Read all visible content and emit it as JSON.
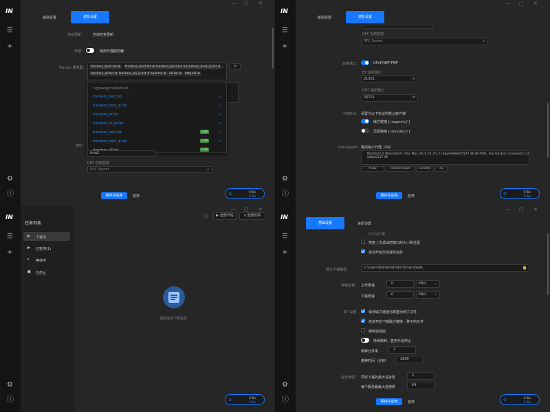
{
  "app": {
    "logo": "IN"
  },
  "sidebar": {
    "menu_icon": "menu-icon",
    "add_icon": "plus-icon",
    "settings_icon": "gear-icon",
    "info_icon": "info-icon"
  },
  "win": {
    "min": "—",
    "max": "▢",
    "close": "✕"
  },
  "tabs": {
    "basic": "基础设置",
    "advanced": "进阶设置"
  },
  "actions": {
    "save": "保存并应用",
    "discard": "放弃"
  },
  "speed": {
    "up": "0 B/s",
    "down": "0 B/s"
  },
  "p1": {
    "auto_update_label": "自动更新：",
    "auto_update_text": "自动检查更新",
    "proxy_label": "代理：",
    "proxy_text": "使用代理服务器",
    "tracker_label": "Tracker 服务器：",
    "tracker_tags": [
      "trackers_best.txt",
      "trackers_best.txt",
      "trackers_best.txt",
      "trackers_best_ip.txt",
      "trackers_all.txt",
      "trackers_all_ip.txt",
      "best.txt",
      "all.txt",
      "http.txt"
    ],
    "dropdown_header": "ngosang/trackerslist",
    "dropdown_items": [
      {
        "name": "trackers_best.txt",
        "cdn": false
      },
      {
        "name": "trackers_best_ip.txt",
        "cdn": false
      },
      {
        "name": "trackers_all.txt",
        "cdn": false
      },
      {
        "name": "trackers_all_ip.txt",
        "cdn": false
      },
      {
        "name": "trackers_best.txt",
        "cdn": true
      },
      {
        "name": "trackers_best_ip.txt",
        "cdn": true
      },
      {
        "name": "trackers_all.txt",
        "cdn": true
      }
    ],
    "cdn_label": "CDN",
    "rpc_label": "RPC:",
    "rpc_value": "Aria2",
    "rpc_secret_label": "RPC 授权密钥",
    "rpc_secret_placeholder": "RPC Secret"
  },
  "p2": {
    "rpc_secret_label": "RPC 授权密钥",
    "rpc_secret_placeholder": "RPC Secret",
    "port_label": "启用端口：",
    "upnp_text": "UPnP/NAT-PMP",
    "bt_port_label": "BT 监听端口",
    "bt_port_value": "21301",
    "dht_port_label": "DHT 监听端口",
    "dht_port_value": "26701",
    "protocol_label": "下载协议：",
    "protocol_desc": "设置为以下协议的默认客户端",
    "magnet_text": "磁力链接 [ magnet:// ]",
    "thunder_text": "迅雷链接 [ thunder:// ]",
    "ua_label": "User-Agent：",
    "ua_desc": "模拟用户代理（UA）",
    "ua_value_1": "Mozilla/5.0 (Macintosh; Intel Mac OS X 10_15_7) AppleWebKit/537.36 (KHTML, like Gecko) Chrome/111.0.0.0",
    "ua_value_2": "Safari/537.36",
    "ua_presets": [
      "Aria2",
      "Transmission",
      "Chrome",
      "du"
    ]
  },
  "p3": {
    "list_title": "任务列表",
    "nav": [
      "下载中",
      "已暂停(1)",
      "等待中",
      "已停止"
    ],
    "start_all": "全部开始",
    "pause_all": "全部暂停",
    "empty_text": "当前没有下载任务"
  },
  "p4": {
    "top_hidden": "打开自动下载",
    "remember_window": "恢复上次退出时窗口的大小和位置",
    "auto_start": "自动开始未完成的任务",
    "dir_label": "默认下载路径：",
    "dir_value": "C:\\Users\\Administrator\\Downloads",
    "transfer_label": "传输设置：",
    "up_limit_label": "上传限速",
    "up_limit_value": "0",
    "down_limit_label": "下载限速",
    "down_limit_value": "0",
    "unit": "KB/s",
    "bt_label": "BT 设置：",
    "bt_opt1": "保存磁力链接元数据为种子文件",
    "bt_opt2": "自动开始下载磁力链接、种子的文件",
    "bt_opt3": "做种完成后",
    "bt_opt4": "持续做种，直到手动停止",
    "ratio_label": "做种分享率",
    "ratio_value": "2",
    "seed_time_label": "做种时间（分钟）",
    "seed_time_value": "2880",
    "task_label": "任务管理：",
    "max_tasks_label": "同时下载的最大任务数",
    "max_tasks_value": "5",
    "max_conn_label": "每个服务器最大连接数",
    "max_conn_value": "64"
  }
}
